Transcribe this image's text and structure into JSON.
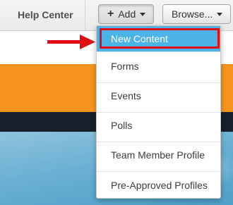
{
  "toolbar": {
    "help_label": "Help Center",
    "add_label": "Add",
    "browse_label": "Browse..."
  },
  "menu": {
    "items": [
      {
        "label": "New Content"
      },
      {
        "label": "Forms"
      },
      {
        "label": "Events"
      },
      {
        "label": "Polls"
      },
      {
        "label": "Team Member Profile"
      },
      {
        "label": "Pre-Approved Profiles"
      }
    ]
  },
  "colors": {
    "highlight_item": "#4bb3e6",
    "annotation": "#e10b12",
    "banner_orange": "#f7941d",
    "banner_dark": "#17202a"
  },
  "icons": [
    "plus-icon",
    "caret-down-icon",
    "annotation-arrow"
  ]
}
